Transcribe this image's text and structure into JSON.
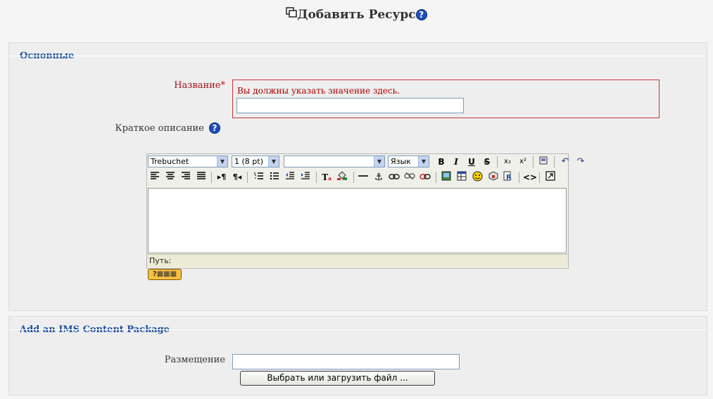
{
  "page": {
    "title": "Добавить Ресурс"
  },
  "sections": {
    "general": {
      "legend": "Основные",
      "name_label": "Название",
      "name_error": "Вы должны указать значение здесь.",
      "name_value": "",
      "summary_label": "Краткое описание"
    },
    "ims": {
      "legend": "Add an IMS Content Package",
      "location_label": "Размещение",
      "location_value": "",
      "choose_button": "Выбрать или загрузить файл ..."
    }
  },
  "editor": {
    "font_family": "Trebuchet",
    "font_size": "1 (8 pt)",
    "format": "",
    "language": "Язык",
    "path_label": "Путь:"
  },
  "icons": {
    "help": "?",
    "keyboard": "?"
  },
  "colors": {
    "legend": "#1a50a0",
    "error": "#aa0000",
    "error_border": "#cc3333",
    "required_label": "#a0121a"
  }
}
